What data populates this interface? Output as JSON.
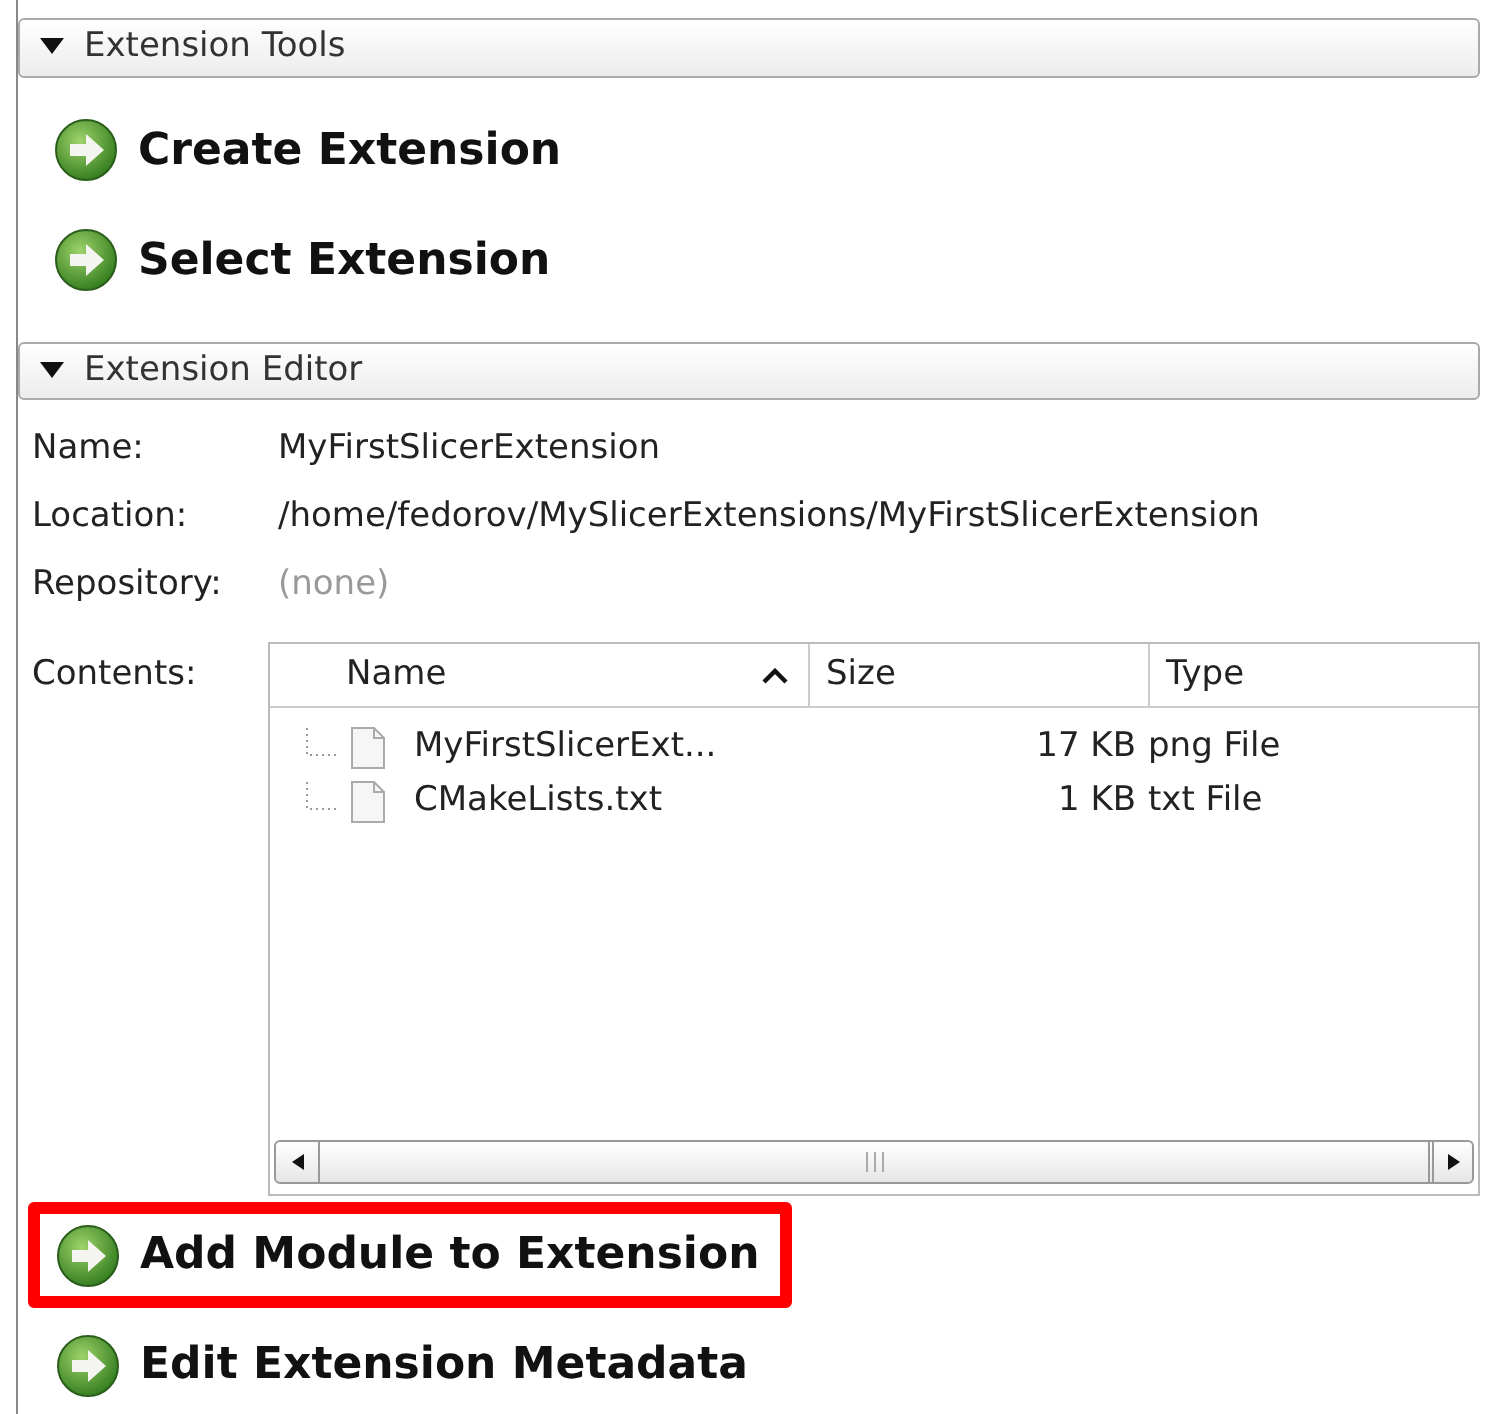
{
  "tools": {
    "title": "Extension Tools",
    "expanded": true,
    "actions": [
      {
        "label": "Create Extension",
        "highlighted": false
      },
      {
        "label": "Select Extension",
        "highlighted": false
      }
    ]
  },
  "editor": {
    "title": "Extension Editor",
    "expanded": true,
    "fields": [
      {
        "label": "Name:",
        "value": "MyFirstSlicerExtension",
        "empty": false
      },
      {
        "label": "Location:",
        "value": "/home/fedorov/MySlicerExtensions/MyFirstSlicerExtension",
        "empty": false
      },
      {
        "label": "Repository:",
        "value": "(none)",
        "empty": true
      }
    ],
    "contents": {
      "label": "Contents:",
      "columns": [
        {
          "label": "Name",
          "sorted": true
        },
        {
          "label": "Size",
          "sorted": false
        },
        {
          "label": "Type",
          "sorted": false
        }
      ],
      "rows": [
        {
          "name": "MyFirstSlicerExt...",
          "size": "17 KB",
          "type": "png File"
        },
        {
          "name": "CMakeLists.txt",
          "size": "1 KB",
          "type": "txt File"
        }
      ]
    },
    "actions": [
      {
        "label": "Add Module to Extension",
        "highlighted": true
      },
      {
        "label": "Edit Extension Metadata",
        "highlighted": false
      }
    ]
  }
}
